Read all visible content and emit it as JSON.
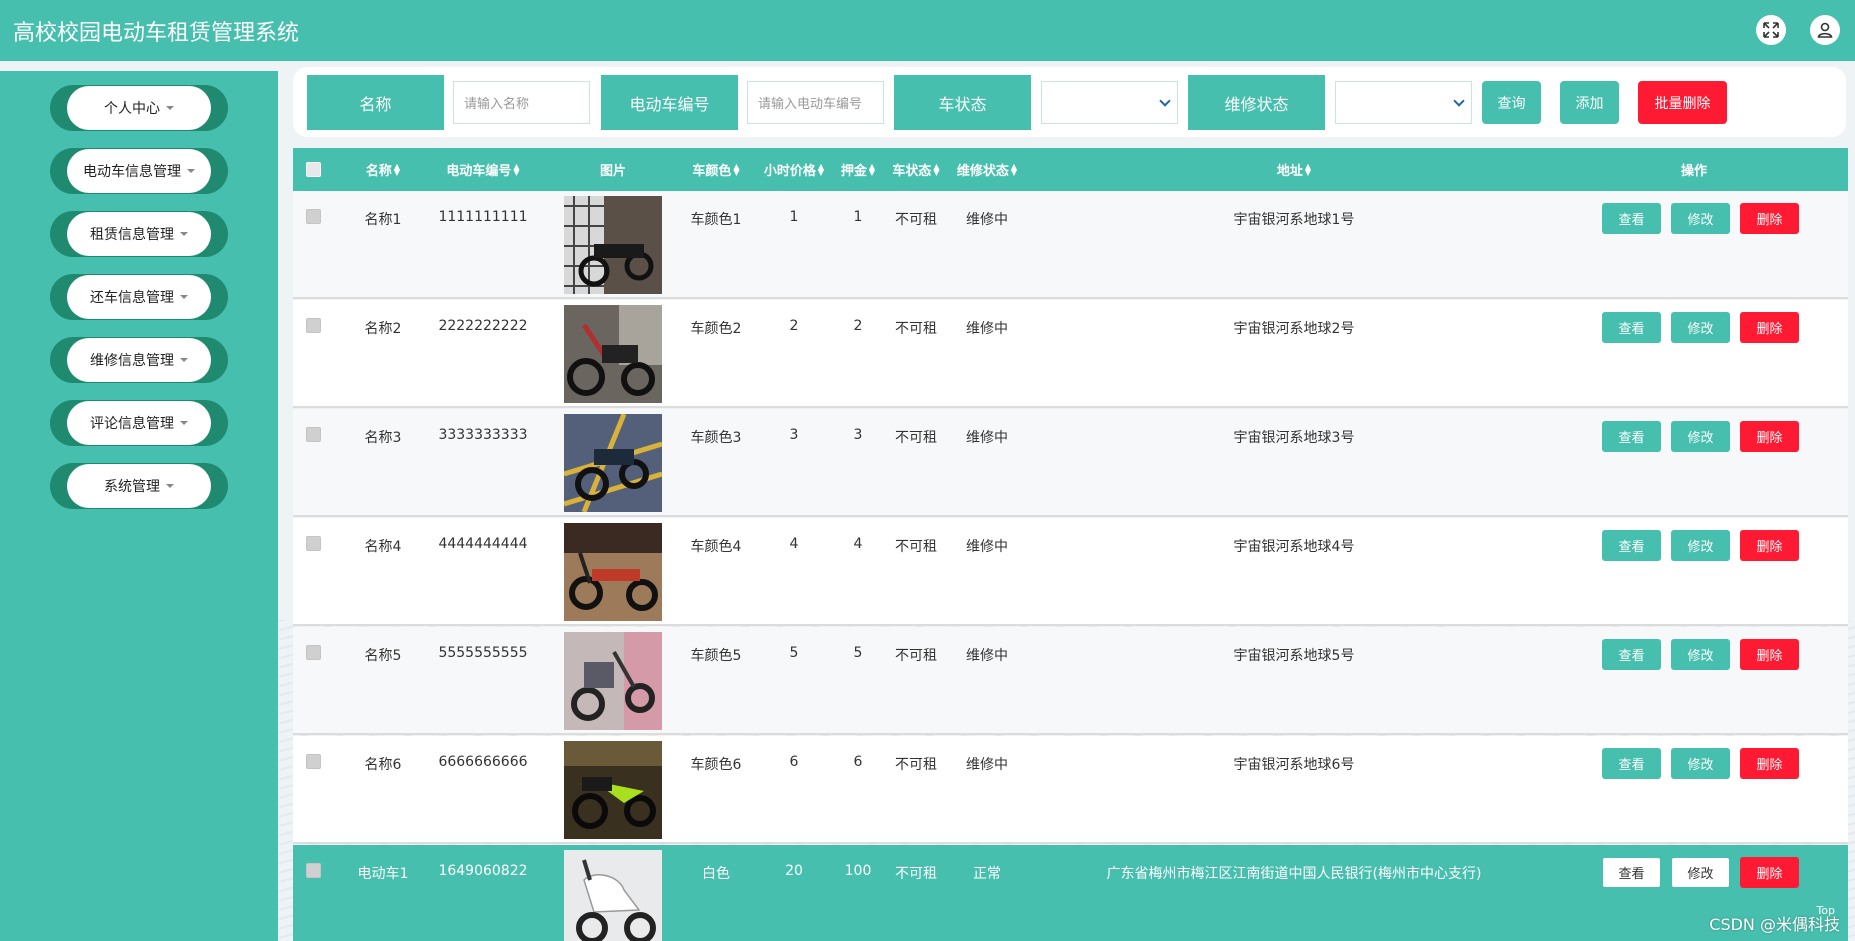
{
  "header": {
    "title": "高校校园电动车租赁管理系统",
    "icons": [
      "fullscreen-icon",
      "user-icon"
    ]
  },
  "sidebar": {
    "items": [
      {
        "label": "个人中心"
      },
      {
        "label": "电动车信息管理"
      },
      {
        "label": "租赁信息管理"
      },
      {
        "label": "还车信息管理"
      },
      {
        "label": "维修信息管理"
      },
      {
        "label": "评论信息管理"
      },
      {
        "label": "系统管理"
      }
    ]
  },
  "search": {
    "name_label": "名称",
    "name_placeholder": "请输入名称",
    "code_label": "电动车编号",
    "code_placeholder": "请输入电动车编号",
    "status_label": "车状态",
    "status_value": "",
    "repair_label": "维修状态",
    "repair_value": "",
    "query_label": "查询",
    "add_label": "添加",
    "batch_delete_label": "批量删除"
  },
  "table": {
    "headers": {
      "name": "名称",
      "code": "电动车编号",
      "image": "图片",
      "color": "车颜色",
      "price": "小时价格",
      "deposit": "押金",
      "status": "车状态",
      "repair": "维修状态",
      "address": "地址",
      "actions": "操作"
    },
    "actions": {
      "view": "查看",
      "edit": "修改",
      "delete": "删除"
    },
    "rows": [
      {
        "name": "名称1",
        "code": "1111111111",
        "color": "车颜色1",
        "price": "1",
        "deposit": "1",
        "status": "不可租",
        "repair": "维修中",
        "address": "宇宙银河系地球1号"
      },
      {
        "name": "名称2",
        "code": "2222222222",
        "color": "车颜色2",
        "price": "2",
        "deposit": "2",
        "status": "不可租",
        "repair": "维修中",
        "address": "宇宙银河系地球2号"
      },
      {
        "name": "名称3",
        "code": "3333333333",
        "color": "车颜色3",
        "price": "3",
        "deposit": "3",
        "status": "不可租",
        "repair": "维修中",
        "address": "宇宙银河系地球3号"
      },
      {
        "name": "名称4",
        "code": "4444444444",
        "color": "车颜色4",
        "price": "4",
        "deposit": "4",
        "status": "不可租",
        "repair": "维修中",
        "address": "宇宙银河系地球4号"
      },
      {
        "name": "名称5",
        "code": "5555555555",
        "color": "车颜色5",
        "price": "5",
        "deposit": "5",
        "status": "不可租",
        "repair": "维修中",
        "address": "宇宙银河系地球5号"
      },
      {
        "name": "名称6",
        "code": "6666666666",
        "color": "车颜色6",
        "price": "6",
        "deposit": "6",
        "status": "不可租",
        "repair": "维修中",
        "address": "宇宙银河系地球6号"
      },
      {
        "name": "电动车1",
        "code": "1649060822",
        "color": "白色",
        "price": "20",
        "deposit": "100",
        "status": "不可租",
        "repair": "正常",
        "address": "广东省梅州市梅江区江南街道中国人民银行(梅州市中心支行)"
      }
    ]
  },
  "footer": {
    "top_label": "Top",
    "watermark": "CSDN @米偶科技"
  },
  "colors": {
    "primary": "#47bfae",
    "danger": "#ff1a33",
    "menu_dark": "#1f8a6f"
  }
}
